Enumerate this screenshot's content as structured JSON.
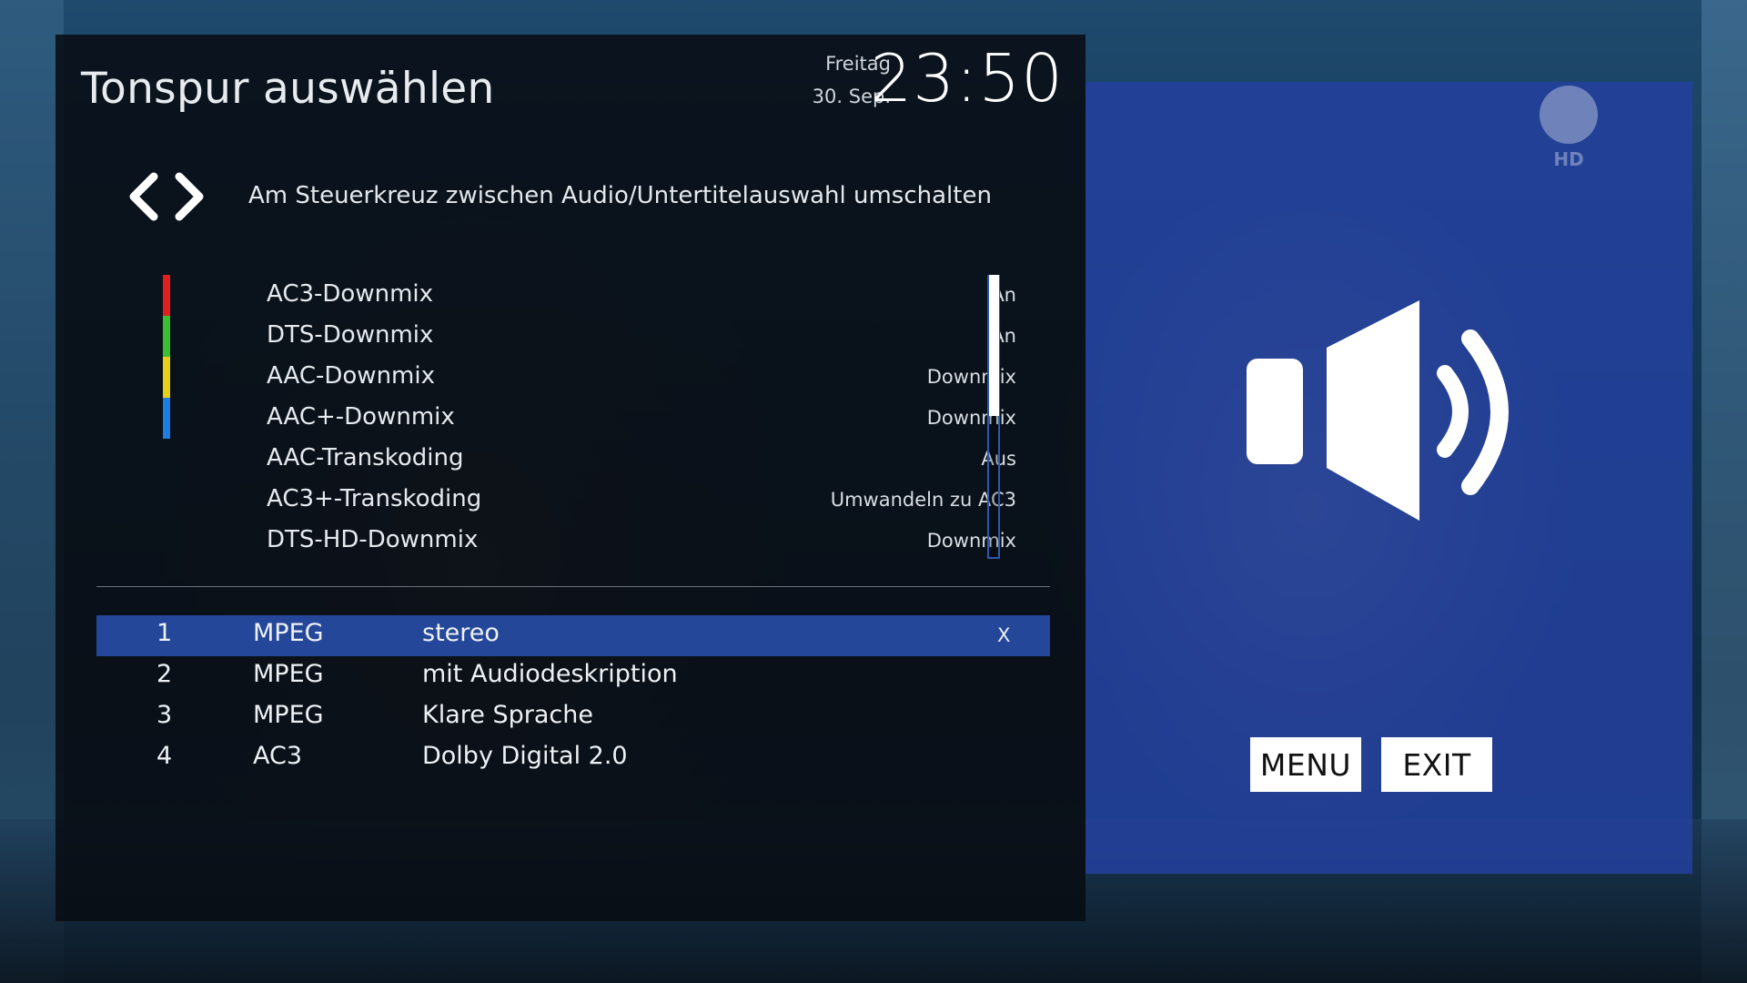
{
  "dialog": {
    "title": "Tonspur auswählen",
    "clock": {
      "day": "Freitag",
      "date": "30. Sep.",
      "time": "23:50"
    },
    "hint": {
      "icon": "left-right-arrows-icon",
      "text": "Am Steuerkreuz zwischen Audio/Untertitelauswahl umschalten"
    },
    "color_keys": [
      "#e02020",
      "#38c030",
      "#e8d018",
      "#1e7ee0"
    ],
    "settings": [
      {
        "label": "AC3-Downmix",
        "value": "An"
      },
      {
        "label": "DTS-Downmix",
        "value": "An"
      },
      {
        "label": "AAC-Downmix",
        "value": "Downmix"
      },
      {
        "label": "AAC+-Downmix",
        "value": "Downmix"
      },
      {
        "label": "AAC-Transkoding",
        "value": "Aus"
      },
      {
        "label": "AC3+-Transkoding",
        "value": "Umwandeln zu AC3"
      },
      {
        "label": "DTS-HD-Downmix",
        "value": "Downmix"
      }
    ],
    "tracks": [
      {
        "num": "1",
        "codec": "MPEG",
        "desc": "stereo",
        "mark": "X",
        "selected": true
      },
      {
        "num": "2",
        "codec": "MPEG",
        "desc": "mit Audiodeskription",
        "mark": "",
        "selected": false
      },
      {
        "num": "3",
        "codec": "MPEG",
        "desc": "Klare Sprache",
        "mark": "",
        "selected": false
      },
      {
        "num": "4",
        "codec": "AC3",
        "desc": "Dolby Digital 2.0",
        "mark": "",
        "selected": false
      }
    ]
  },
  "side_panel": {
    "icon": "speaker-volume-icon",
    "channel_logo": "channel-logo-icon",
    "channel_logo_text": "HD",
    "accent": "#2440a0"
  },
  "buttons": {
    "menu": "MENU",
    "exit": "EXIT"
  }
}
